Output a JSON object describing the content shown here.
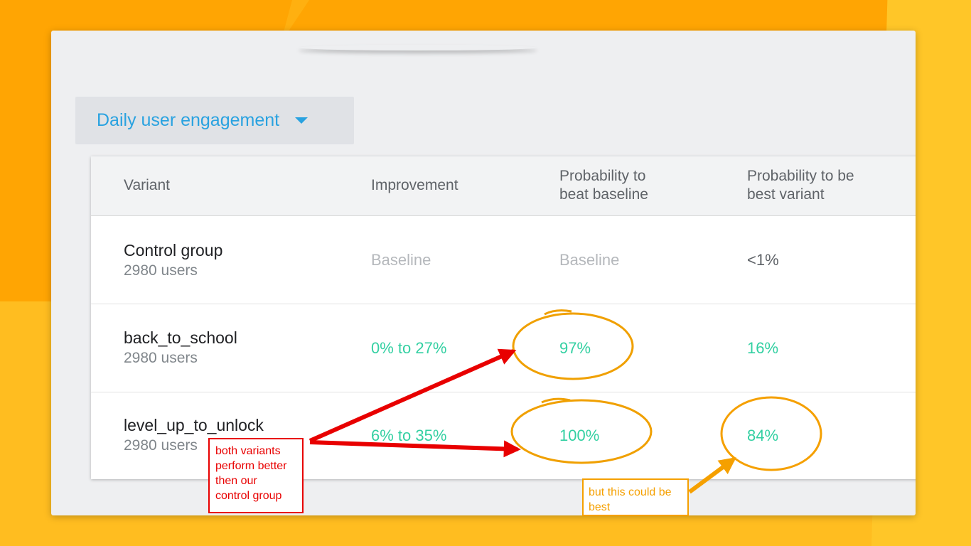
{
  "metric_dropdown": {
    "label": "Daily user engagement",
    "icon": "dropdown-caret-icon"
  },
  "table": {
    "headers": [
      {
        "line1": "Variant",
        "line2": ""
      },
      {
        "line1": "Improvement",
        "line2": ""
      },
      {
        "line1": "Probability to",
        "line2": "beat baseline"
      },
      {
        "line1": "Probability to be",
        "line2": "best variant"
      }
    ],
    "rows": [
      {
        "name": "Control group",
        "users": "2980 users",
        "improvement": "Baseline",
        "beat_baseline": "Baseline",
        "best_variant": "<1%"
      },
      {
        "name": "back_to_school",
        "users": "2980 users",
        "improvement": "0% to 27%",
        "beat_baseline": "97%",
        "best_variant": "16%"
      },
      {
        "name": "level_up_to_unlock",
        "users": "2980 users",
        "improvement": "6% to 35%",
        "beat_baseline": "100%",
        "best_variant": "84%"
      }
    ]
  },
  "annotations": {
    "red_note": [
      "both variants",
      "perform better",
      "then our",
      "control group"
    ],
    "orange_note": [
      "but this could be",
      "best"
    ]
  },
  "colors": {
    "background_orange": "#ffa503",
    "background_yellow": "#ffbd20",
    "accent_blue": "#29a2e0",
    "positive_green": "#33d0a2",
    "annotation_red": "#e80000",
    "annotation_orange": "#f5a000"
  }
}
